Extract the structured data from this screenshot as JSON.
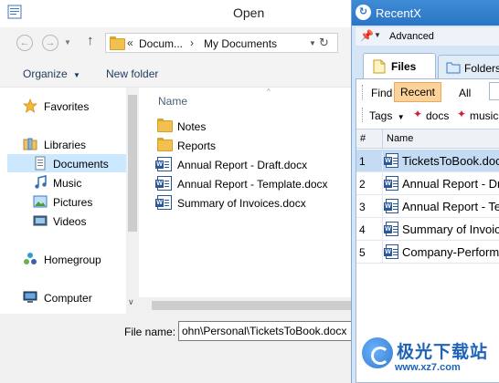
{
  "open_dialog": {
    "title": "Open",
    "breadcrumb": {
      "overflow": "«",
      "part1": "Docum...",
      "sep": "›",
      "part2": "My Documents"
    },
    "toolbar": {
      "organize_label": "Organize",
      "new_folder_label": "New folder"
    },
    "nav_items": {
      "favorites": "Favorites",
      "libraries": "Libraries",
      "documents": "Documents",
      "music": "Music",
      "pictures": "Pictures",
      "videos": "Videos",
      "homegroup": "Homegroup",
      "computer": "Computer"
    },
    "file_list": {
      "column_name": "Name",
      "items": [
        {
          "name": "Notes",
          "icon": "folder-icon"
        },
        {
          "name": "Reports",
          "icon": "folder-icon"
        },
        {
          "name": "Annual Report - Draft.docx",
          "icon": "word-doc-icon"
        },
        {
          "name": "Annual Report - Template.docx",
          "icon": "word-doc-icon"
        },
        {
          "name": "Summary of Invoices.docx",
          "icon": "word-doc-icon"
        }
      ]
    },
    "file_name_label": "File name:",
    "file_name_value": "ohn\\Personal\\TicketsToBook.docx"
  },
  "recentx": {
    "title": "RecentX",
    "advanced_label": "Advanced",
    "tabs": {
      "files": "Files",
      "folders": "Folders"
    },
    "filter": {
      "find": "Find",
      "recent": "Recent",
      "all": "All"
    },
    "tags": {
      "label": "Tags",
      "tag1": "docs",
      "tag2": "music"
    },
    "grid": {
      "col_num": "#",
      "col_name": "Name",
      "rows": [
        {
          "num": "1",
          "name": "TicketsToBook.docx"
        },
        {
          "num": "2",
          "name": "Annual Report - Dr"
        },
        {
          "num": "3",
          "name": "Annual Report - Te"
        },
        {
          "num": "4",
          "name": "Summary of Invoic"
        },
        {
          "num": "5",
          "name": "Company-Performa"
        }
      ]
    }
  },
  "watermark": {
    "cn_text": "极光下载站",
    "url": "www.xz7.com"
  }
}
